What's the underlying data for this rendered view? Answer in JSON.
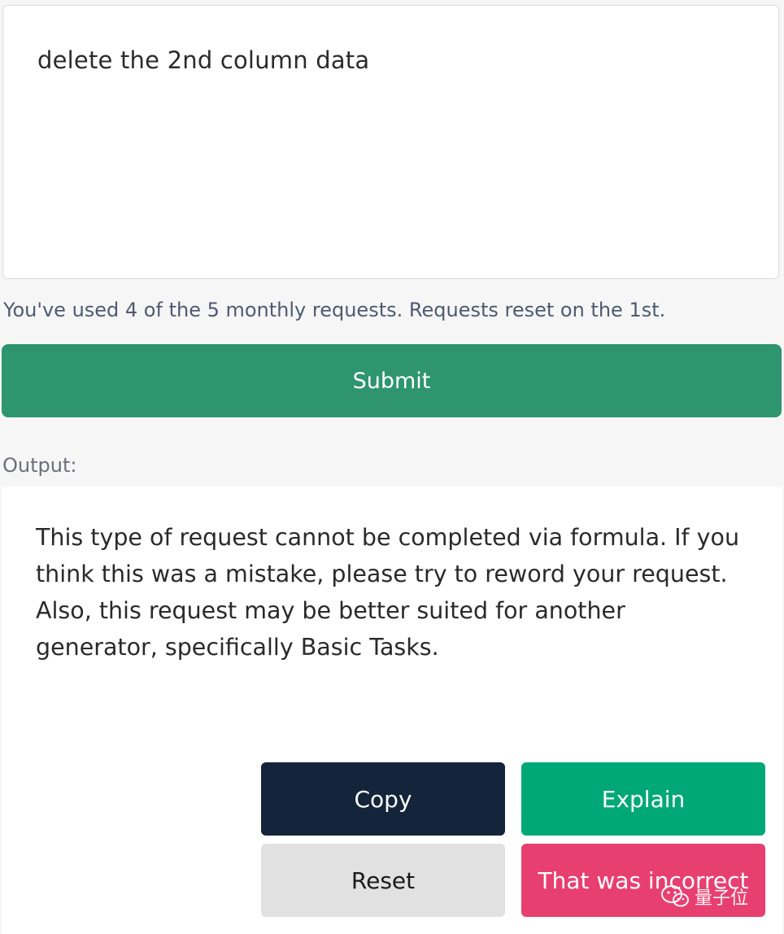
{
  "prompt": {
    "text": "delete the 2nd column data"
  },
  "usage_note": "You've used 4 of the 5 monthly requests. Requests reset on the 1st.",
  "submit_label": "Submit",
  "output": {
    "label": "Output:",
    "text": "This type of request cannot be completed via formula. If you think this was a mistake, please try to reword your request. Also, this request may be better suited for another generator, specifically Basic Tasks."
  },
  "actions": {
    "copy_label": "Copy",
    "explain_label": "Explain",
    "reset_label": "Reset",
    "incorrect_label": "That was incorrect"
  },
  "watermark": {
    "text": "量子位",
    "icon": "wechat-icon"
  },
  "colors": {
    "submit": "#2e9570",
    "copy": "#14243a",
    "explain": "#00a878",
    "reset": "#e1e1e1",
    "incorrect": "#e83f71"
  }
}
